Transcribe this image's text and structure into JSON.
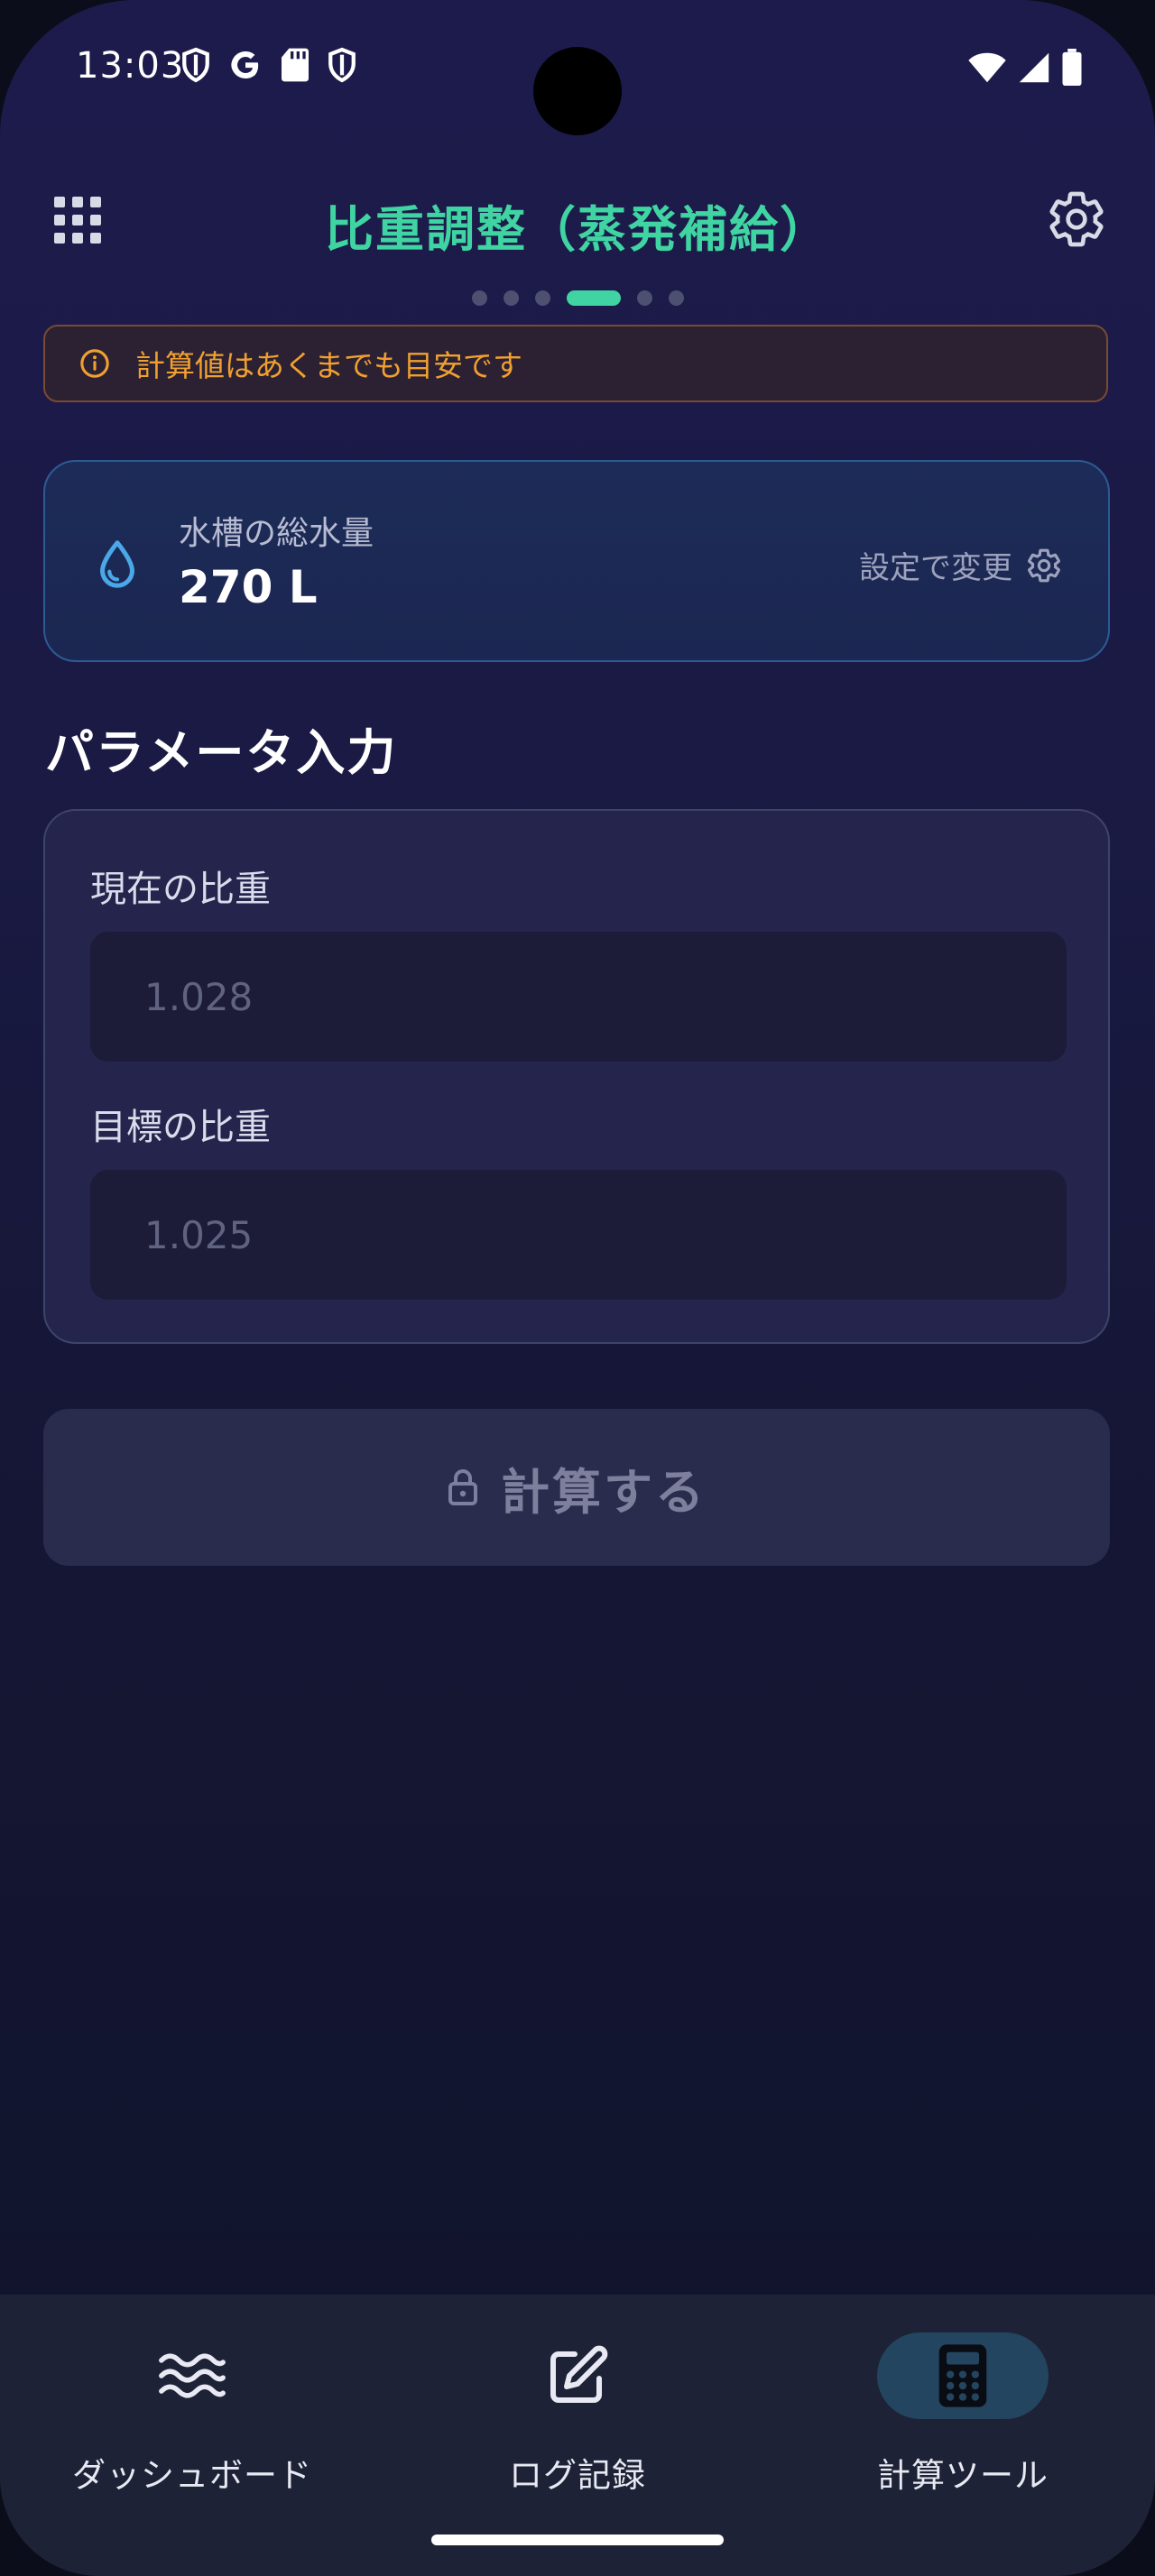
{
  "status_bar": {
    "time": "13:03",
    "icons": [
      "shield-icon",
      "google-icon",
      "sd-card-icon",
      "shield-icon",
      "wifi-icon",
      "signal-icon",
      "battery-icon"
    ]
  },
  "header": {
    "title": "比重調整（蒸発補給）",
    "left_icon": "apps-grid-icon",
    "right_icon": "gear-icon"
  },
  "pager": {
    "count": 6,
    "active_index": 3
  },
  "warning": {
    "text": "計算値はあくまでも目安です",
    "color": "#f0a030"
  },
  "tank": {
    "label": "水槽の総水量",
    "value": "270 L",
    "change_label": "設定で変更"
  },
  "params": {
    "section_title": "パラメータ入力",
    "current_label": "現在の比重",
    "current_placeholder": "1.028",
    "target_label": "目標の比重",
    "target_placeholder": "1.025"
  },
  "actions": {
    "calculate_label": "計算する"
  },
  "nav": {
    "items": [
      {
        "label": "ダッシュボード",
        "icon": "waves-icon"
      },
      {
        "label": "ログ記録",
        "icon": "edit-icon"
      },
      {
        "label": "計算ツール",
        "icon": "calculator-icon"
      }
    ],
    "active_index": 2
  },
  "colors": {
    "accent": "#3fd4a2",
    "warning": "#f0a030",
    "drop": "#4aa8e8"
  }
}
